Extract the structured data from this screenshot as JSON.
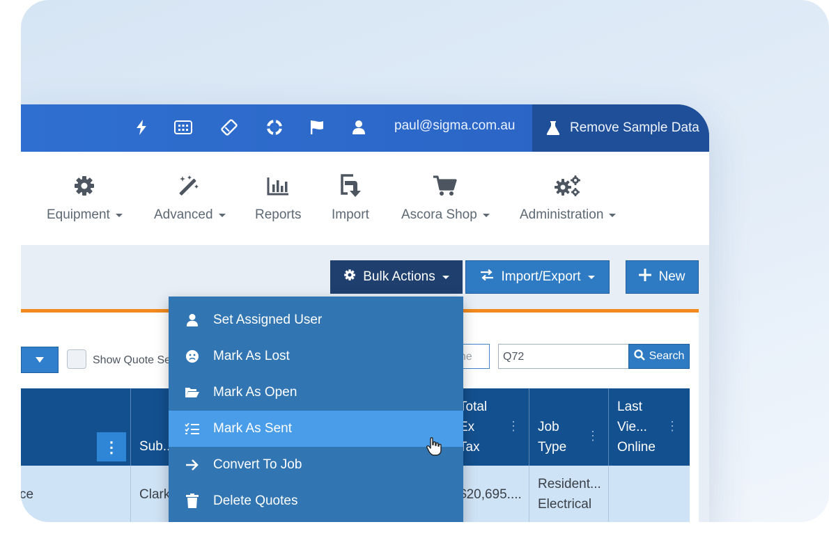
{
  "topbar": {
    "icons": [
      "lightning-icon",
      "grid-icon",
      "ticket-icon",
      "lifebuoy-icon",
      "flag-icon",
      "user-icon"
    ],
    "user_email": "paul@sigma.com.au",
    "remove_sample_label": "Remove Sample Data"
  },
  "menu": {
    "items": [
      {
        "label": "Equipment",
        "icon": "gear-icon",
        "dropdown": true
      },
      {
        "label": "Advanced",
        "icon": "magic-wand-icon",
        "dropdown": true
      },
      {
        "label": "Reports",
        "icon": "bar-chart-icon",
        "dropdown": false
      },
      {
        "label": "Import",
        "icon": "import-icon",
        "dropdown": false
      },
      {
        "label": "Ascora Shop",
        "icon": "cart-icon",
        "dropdown": true
      },
      {
        "label": "Administration",
        "icon": "gears-icon",
        "dropdown": true
      }
    ]
  },
  "actions": {
    "bulk_actions_label": "Bulk Actions",
    "import_export_label": "Import/Export",
    "new_label": "New"
  },
  "filters": {
    "show_quote_label": "Show Quote Se",
    "field_stub_text": "ne",
    "search_value": "Q72",
    "search_button_label": "Search"
  },
  "table": {
    "columns": [
      {
        "label": "Sub..."
      },
      {
        "label_lines": [
          "Total",
          "Ex",
          "Tax"
        ]
      },
      {
        "label_lines": [
          "Job",
          "Type"
        ]
      },
      {
        "label_lines": [
          "Last",
          "Vie...",
          "Online"
        ]
      }
    ],
    "row": {
      "cell_first": "ce",
      "cell_sub": "Clark",
      "cell_total": "$20,695....",
      "cell_jobtype_lines": [
        "Resident...",
        "Electrical"
      ]
    }
  },
  "bulk_menu": {
    "items": [
      {
        "label": "Set Assigned User",
        "icon": "user-icon"
      },
      {
        "label": "Mark As Lost",
        "icon": "frown-icon"
      },
      {
        "label": "Mark As Open",
        "icon": "folder-open-icon"
      },
      {
        "label": "Mark As Sent",
        "icon": "list-check-icon",
        "active": true
      },
      {
        "label": "Convert To Job",
        "icon": "arrow-right-icon"
      },
      {
        "label": "Delete Quotes",
        "icon": "trash-icon"
      }
    ]
  },
  "colors": {
    "topbar": "#2f6fcf",
    "remove_sample_bg": "#1f4f99",
    "bulk_button": "#1f3f6f",
    "primary_button": "#2e7bc4",
    "accent_line": "#f28a1e",
    "table_header": "#13508f",
    "dropdown_bg": "#3176b3",
    "dropdown_active": "#4a9de8"
  }
}
